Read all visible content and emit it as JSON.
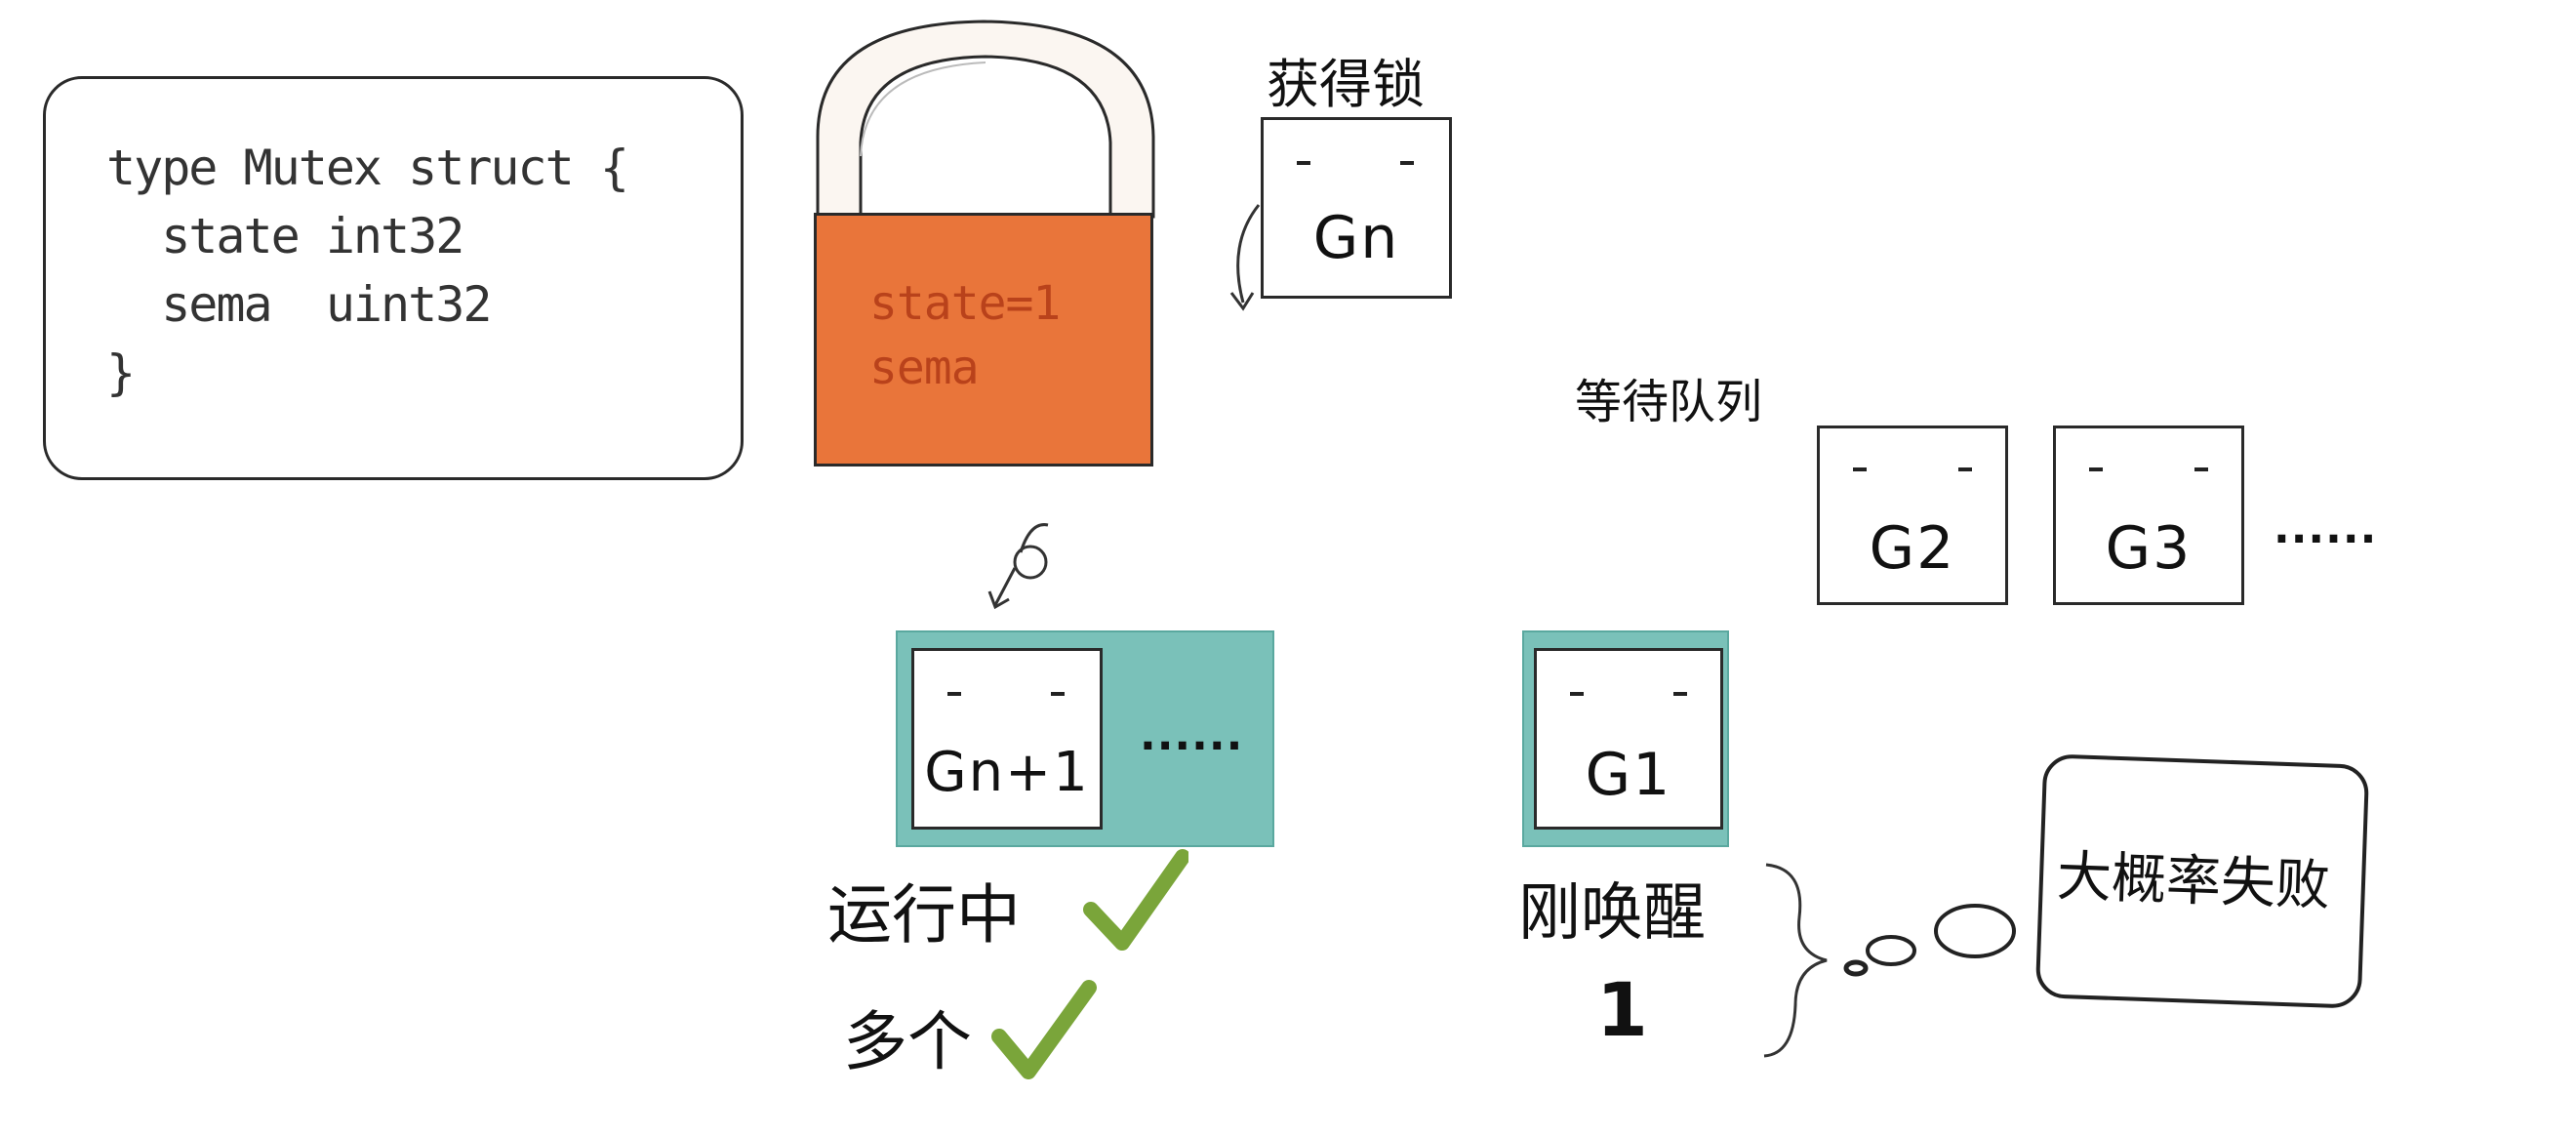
{
  "code": {
    "lines": [
      "type Mutex struct {",
      "  state int32",
      "  sema  uint32",
      "}"
    ]
  },
  "lock": {
    "state_label": "state=1",
    "sema_label": "sema"
  },
  "acquired": {
    "caption": "获得锁",
    "goroutine": "Gn"
  },
  "wait_queue": {
    "caption": "等待队列",
    "goroutines": [
      "G2",
      "G3"
    ],
    "more": "......"
  },
  "running": {
    "goroutine": "Gn+1",
    "more": "......",
    "status_label": "运行中",
    "count_label": "多个"
  },
  "woken": {
    "goroutine": "G1",
    "status_label": "刚唤醒",
    "count": "1"
  },
  "thought": {
    "text": "大概率失败"
  },
  "colors": {
    "lock_orange": "#e9753a",
    "teal_highlight": "#7ac1b9",
    "check_green": "#7aa53a"
  }
}
